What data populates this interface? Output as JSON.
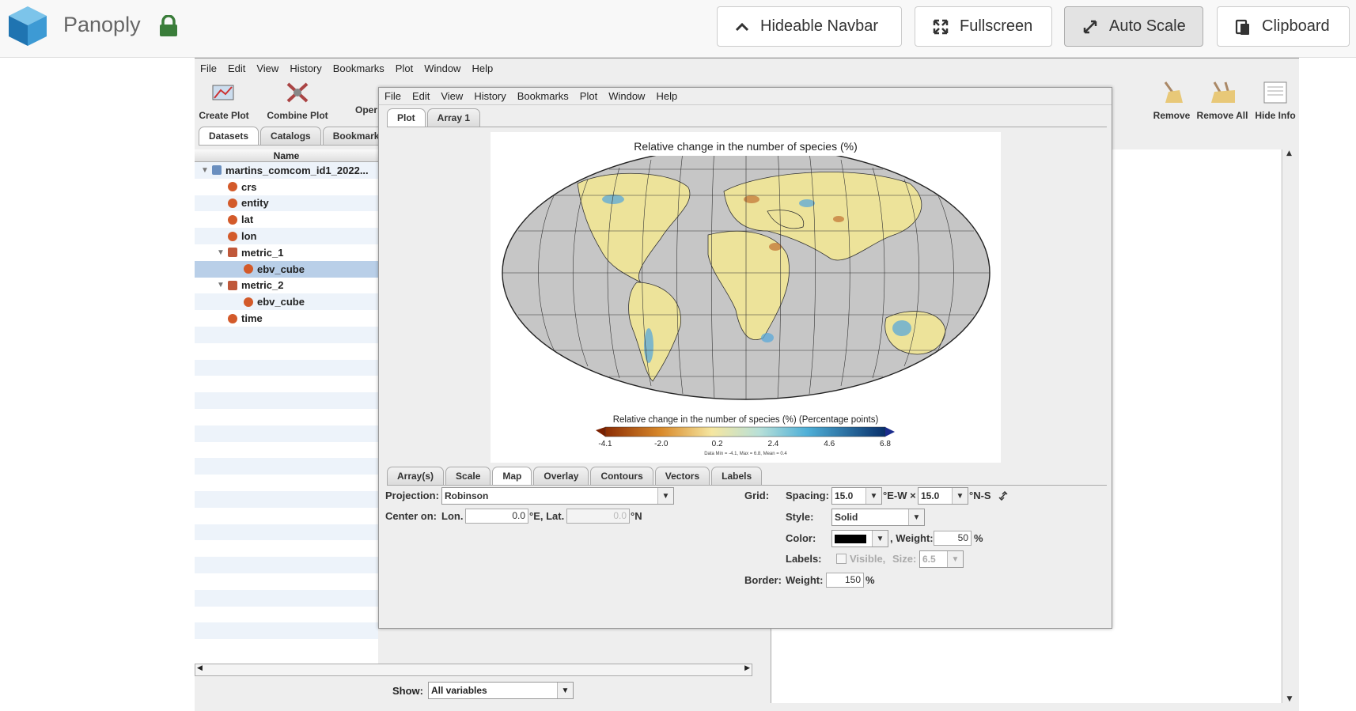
{
  "topbar": {
    "brand": "Panoply",
    "buttons": [
      {
        "label": "Hideable Navbar",
        "icon": "chevron-up-icon"
      },
      {
        "label": "Fullscreen",
        "icon": "expand-icon"
      },
      {
        "label": "Auto Scale",
        "icon": "resize-icon",
        "active": true
      },
      {
        "label": "Clipboard",
        "icon": "clipboard-icon"
      }
    ]
  },
  "main_menu": [
    "File",
    "Edit",
    "View",
    "History",
    "Bookmarks",
    "Plot",
    "Window",
    "Help"
  ],
  "toolbar": {
    "create_plot": "Create Plot",
    "combine_plot": "Combine Plot",
    "open": "Oper",
    "remove": "Remove",
    "remove_all": "Remove All",
    "hide_info": "Hide Info"
  },
  "datasets_tabs": [
    "Datasets",
    "Catalogs",
    "Bookmarks"
  ],
  "tree": {
    "header": "Name",
    "rows": [
      {
        "label": "martins_comcom_id1_2022...",
        "level": 0,
        "type": "file",
        "expanded": true
      },
      {
        "label": "crs",
        "level": 1,
        "type": "var"
      },
      {
        "label": "entity",
        "level": 1,
        "type": "var"
      },
      {
        "label": "lat",
        "level": 1,
        "type": "var"
      },
      {
        "label": "lon",
        "level": 1,
        "type": "var"
      },
      {
        "label": "metric_1",
        "level": 1,
        "type": "group",
        "expanded": true
      },
      {
        "label": "ebv_cube",
        "level": 2,
        "type": "var",
        "selected": true
      },
      {
        "label": "metric_2",
        "level": 1,
        "type": "group",
        "expanded": true
      },
      {
        "label": "ebv_cube",
        "level": 2,
        "type": "var"
      },
      {
        "label": "time",
        "level": 1,
        "type": "var"
      }
    ]
  },
  "show": {
    "label": "Show:",
    "value": "All variables"
  },
  "plot_window": {
    "menu": [
      "File",
      "Edit",
      "View",
      "History",
      "Bookmarks",
      "Plot",
      "Window",
      "Help"
    ],
    "tabs": [
      "Plot",
      "Array 1"
    ],
    "plot_title": "Relative change in the number of species (%)",
    "colorbar_title": "Relative change in the number of species (%) (Percentage points)",
    "colorbar_ticks": [
      "-4.1",
      "-2.0",
      "0.2",
      "2.4",
      "4.6",
      "6.8"
    ],
    "stats": "Data Min = -4.1, Max = 6.8, Mean = 0.4",
    "control_tabs": [
      "Array(s)",
      "Scale",
      "Map",
      "Overlay",
      "Contours",
      "Vectors",
      "Labels"
    ],
    "map_panel": {
      "projection_label": "Projection:",
      "projection_value": "Robinson",
      "center_label": "Center on:",
      "lon_label": "Lon.",
      "lon_value": "0.0",
      "lon_unit": "°E, Lat.",
      "lat_value": "0.0",
      "lat_unit": "°N",
      "grid_label": "Grid:",
      "spacing_label": "Spacing:",
      "spacing_ew": "15.0",
      "spacing_ew_unit": "°E-W ×",
      "spacing_ns": "15.0",
      "spacing_ns_unit": "°N-S",
      "style_label": "Style:",
      "style_value": "Solid",
      "color_label": "Color:",
      "weight_label": ", Weight:",
      "weight_value": "50",
      "percent": "%",
      "labels_label": "Labels:",
      "visible_label": "Visible,",
      "size_label": "Size:",
      "size_value": "6.5",
      "border_label": "Border:",
      "border_weight_label": "Weight:",
      "border_weight_value": "150"
    }
  },
  "colors": {
    "selected_row": "#b9cfe8",
    "alt_row": "#edf3fa",
    "lock": "#3a7d3a"
  }
}
